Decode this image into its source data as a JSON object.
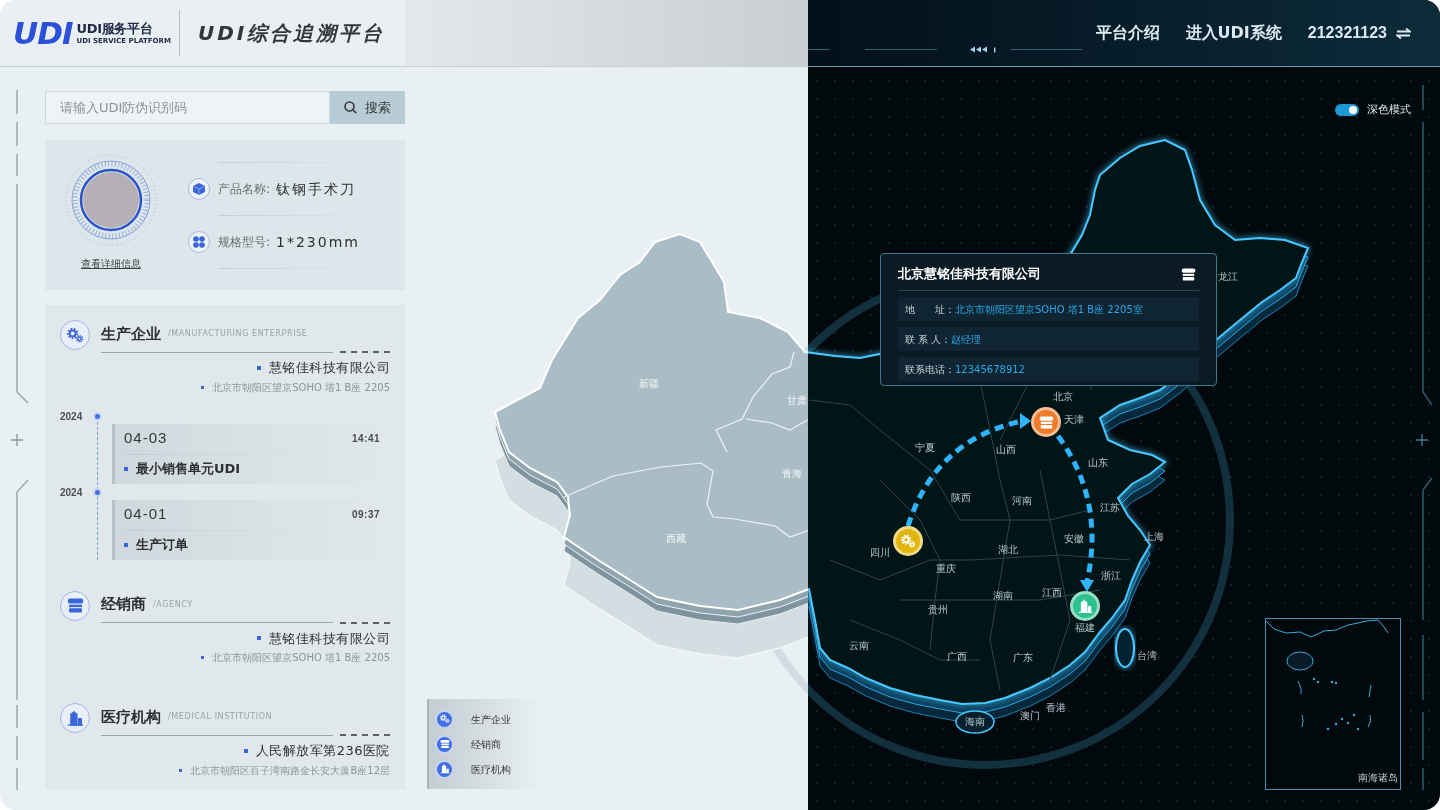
{
  "header": {
    "logo_mark": "UDI",
    "logo_name": "UDI服务平台",
    "logo_tagline": "UDI SERVICE PLATFORM",
    "title": "UDI综合追溯平台",
    "nav": [
      "平台介绍",
      "进入UDI系统"
    ],
    "account": "212321123"
  },
  "search": {
    "placeholder": "请输入UDI防伪识别码",
    "button": "搜索"
  },
  "product": {
    "detail_link": "查看详细信息",
    "fields": [
      {
        "kind": "name",
        "label": "产品名称:",
        "value": "钛钢手术刀"
      },
      {
        "kind": "model",
        "label": "规格型号:",
        "value": "1*230mm"
      }
    ]
  },
  "trace": [
    {
      "kind": "manufacturer",
      "title": "生产企业",
      "subtitle": "/MANUFACTURING ENTERPRISE",
      "company": "慧铭佳科技有限公司",
      "address": "北京市朝阳区望京SOHO 塔1 B座 2205",
      "events": [
        {
          "year": "2024",
          "date": "04-03",
          "time": "14:41",
          "label": "最小销售单元UDI"
        },
        {
          "year": "2024",
          "date": "04-01",
          "time": "09:37",
          "label": "生产订单"
        }
      ]
    },
    {
      "kind": "agency",
      "title": "经销商",
      "subtitle": "/AGENCY",
      "company": "慧铭佳科技有限公司",
      "address": "北京市朝阳区望京SOHO 塔1 B座 2205"
    },
    {
      "kind": "hospital",
      "title": "医疗机构",
      "subtitle": "/MEDICAL INSTITUTION",
      "company": "人民解放军第236医院",
      "address": "北京市朝阳区百子湾南路金长安大厦B座12层"
    }
  ],
  "legend": [
    {
      "kind": "manufacturer",
      "label": "生产企业"
    },
    {
      "kind": "agency",
      "label": "经销商"
    },
    {
      "kind": "hospital",
      "label": "医疗机构"
    }
  ],
  "theme_toggle": {
    "label": "深色模式",
    "on": true
  },
  "map": {
    "labels": [
      "龙江",
      "新疆",
      "甘肃",
      "北京",
      "天津",
      "宁夏",
      "山西",
      "山东",
      "青海",
      "陕西",
      "河南",
      "江苏",
      "西藏",
      "安徽",
      "上海",
      "四川",
      "湖北",
      "重庆",
      "浙江",
      "湖南",
      "江西",
      "贵州",
      "福建",
      "云南",
      "广西",
      "广东",
      "台湾",
      "海南",
      "澳门",
      "香港"
    ],
    "markers": [
      {
        "kind": "manufacturer",
        "color": "#e2b40e"
      },
      {
        "kind": "agency",
        "color": "#ef7a2b"
      },
      {
        "kind": "hospital",
        "color": "#2fc08f"
      }
    ],
    "inset_label": "南海诸岛"
  },
  "popup": {
    "title": "北京慧铭佳科技有限公司",
    "rows": [
      {
        "label": "地　　址：",
        "value": "北京市朝阳区望京SOHO 塔1 B座 2205室"
      },
      {
        "label": "联 系 人：",
        "value": "赵经理"
      },
      {
        "label": "联系电话：",
        "value": "12345678912"
      }
    ]
  }
}
